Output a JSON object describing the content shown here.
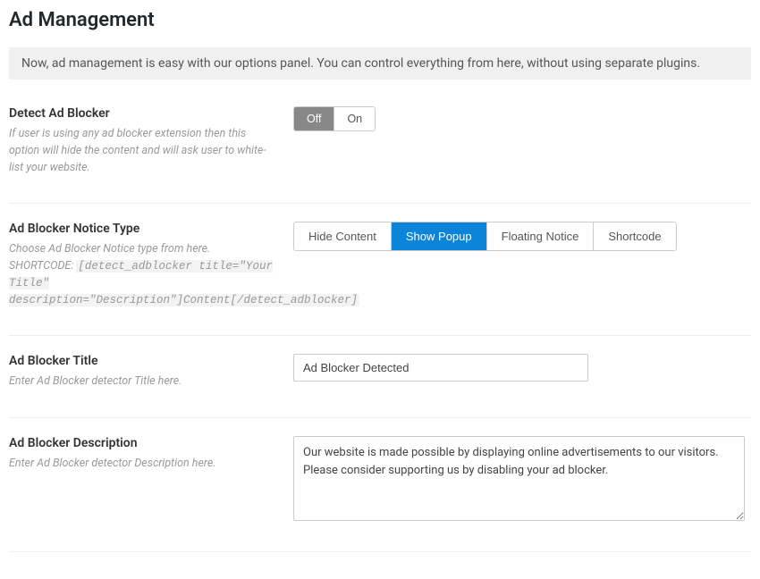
{
  "page": {
    "title": "Ad Management",
    "notice": "Now, ad management is easy with our options panel. You can control everything from here, without using separate plugins."
  },
  "detect_ad_blocker": {
    "label": "Detect Ad Blocker",
    "desc": "If user is using any ad blocker extension then this option will hide the content and will ask user to white-list your website.",
    "off": "Off",
    "on": "On"
  },
  "notice_type": {
    "label": "Ad Blocker Notice Type",
    "desc_prefix": "Choose Ad Blocker Notice type from here. SHORTCODE:",
    "shortcode": "[detect_adblocker title=\"Your Title\" description=\"Description\"]Content[/detect_adblocker]",
    "options": {
      "hide_content": "Hide Content",
      "show_popup": "Show Popup",
      "floating_notice": "Floating Notice",
      "shortcode_opt": "Shortcode"
    }
  },
  "ad_blocker_title": {
    "label": "Ad Blocker Title",
    "desc": "Enter Ad Blocker detector Title here.",
    "value": "Ad Blocker Detected"
  },
  "ad_blocker_description": {
    "label": "Ad Blocker Description",
    "desc": "Enter Ad Blocker detector Description here.",
    "value": "Our website is made possible by displaying online advertisements to our visitors. Please consider supporting us by disabling your ad blocker."
  }
}
